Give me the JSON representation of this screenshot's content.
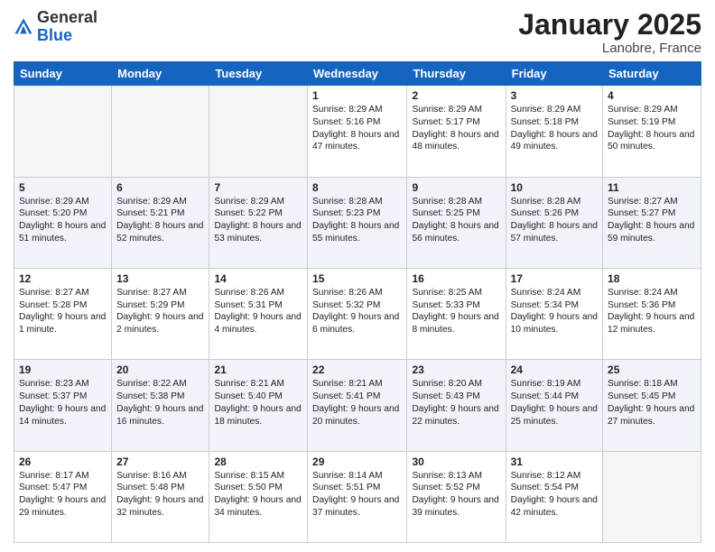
{
  "logo": {
    "general": "General",
    "blue": "Blue"
  },
  "header": {
    "month_year": "January 2025",
    "location": "Lanobre, France"
  },
  "days_of_week": [
    "Sunday",
    "Monday",
    "Tuesday",
    "Wednesday",
    "Thursday",
    "Friday",
    "Saturday"
  ],
  "weeks": [
    [
      {
        "day": "",
        "sunrise": "",
        "sunset": "",
        "daylight": ""
      },
      {
        "day": "",
        "sunrise": "",
        "sunset": "",
        "daylight": ""
      },
      {
        "day": "",
        "sunrise": "",
        "sunset": "",
        "daylight": ""
      },
      {
        "day": "1",
        "sunrise": "Sunrise: 8:29 AM",
        "sunset": "Sunset: 5:16 PM",
        "daylight": "Daylight: 8 hours and 47 minutes."
      },
      {
        "day": "2",
        "sunrise": "Sunrise: 8:29 AM",
        "sunset": "Sunset: 5:17 PM",
        "daylight": "Daylight: 8 hours and 48 minutes."
      },
      {
        "day": "3",
        "sunrise": "Sunrise: 8:29 AM",
        "sunset": "Sunset: 5:18 PM",
        "daylight": "Daylight: 8 hours and 49 minutes."
      },
      {
        "day": "4",
        "sunrise": "Sunrise: 8:29 AM",
        "sunset": "Sunset: 5:19 PM",
        "daylight": "Daylight: 8 hours and 50 minutes."
      }
    ],
    [
      {
        "day": "5",
        "sunrise": "Sunrise: 8:29 AM",
        "sunset": "Sunset: 5:20 PM",
        "daylight": "Daylight: 8 hours and 51 minutes."
      },
      {
        "day": "6",
        "sunrise": "Sunrise: 8:29 AM",
        "sunset": "Sunset: 5:21 PM",
        "daylight": "Daylight: 8 hours and 52 minutes."
      },
      {
        "day": "7",
        "sunrise": "Sunrise: 8:29 AM",
        "sunset": "Sunset: 5:22 PM",
        "daylight": "Daylight: 8 hours and 53 minutes."
      },
      {
        "day": "8",
        "sunrise": "Sunrise: 8:28 AM",
        "sunset": "Sunset: 5:23 PM",
        "daylight": "Daylight: 8 hours and 55 minutes."
      },
      {
        "day": "9",
        "sunrise": "Sunrise: 8:28 AM",
        "sunset": "Sunset: 5:25 PM",
        "daylight": "Daylight: 8 hours and 56 minutes."
      },
      {
        "day": "10",
        "sunrise": "Sunrise: 8:28 AM",
        "sunset": "Sunset: 5:26 PM",
        "daylight": "Daylight: 8 hours and 57 minutes."
      },
      {
        "day": "11",
        "sunrise": "Sunrise: 8:27 AM",
        "sunset": "Sunset: 5:27 PM",
        "daylight": "Daylight: 8 hours and 59 minutes."
      }
    ],
    [
      {
        "day": "12",
        "sunrise": "Sunrise: 8:27 AM",
        "sunset": "Sunset: 5:28 PM",
        "daylight": "Daylight: 9 hours and 1 minute."
      },
      {
        "day": "13",
        "sunrise": "Sunrise: 8:27 AM",
        "sunset": "Sunset: 5:29 PM",
        "daylight": "Daylight: 9 hours and 2 minutes."
      },
      {
        "day": "14",
        "sunrise": "Sunrise: 8:26 AM",
        "sunset": "Sunset: 5:31 PM",
        "daylight": "Daylight: 9 hours and 4 minutes."
      },
      {
        "day": "15",
        "sunrise": "Sunrise: 8:26 AM",
        "sunset": "Sunset: 5:32 PM",
        "daylight": "Daylight: 9 hours and 6 minutes."
      },
      {
        "day": "16",
        "sunrise": "Sunrise: 8:25 AM",
        "sunset": "Sunset: 5:33 PM",
        "daylight": "Daylight: 9 hours and 8 minutes."
      },
      {
        "day": "17",
        "sunrise": "Sunrise: 8:24 AM",
        "sunset": "Sunset: 5:34 PM",
        "daylight": "Daylight: 9 hours and 10 minutes."
      },
      {
        "day": "18",
        "sunrise": "Sunrise: 8:24 AM",
        "sunset": "Sunset: 5:36 PM",
        "daylight": "Daylight: 9 hours and 12 minutes."
      }
    ],
    [
      {
        "day": "19",
        "sunrise": "Sunrise: 8:23 AM",
        "sunset": "Sunset: 5:37 PM",
        "daylight": "Daylight: 9 hours and 14 minutes."
      },
      {
        "day": "20",
        "sunrise": "Sunrise: 8:22 AM",
        "sunset": "Sunset: 5:38 PM",
        "daylight": "Daylight: 9 hours and 16 minutes."
      },
      {
        "day": "21",
        "sunrise": "Sunrise: 8:21 AM",
        "sunset": "Sunset: 5:40 PM",
        "daylight": "Daylight: 9 hours and 18 minutes."
      },
      {
        "day": "22",
        "sunrise": "Sunrise: 8:21 AM",
        "sunset": "Sunset: 5:41 PM",
        "daylight": "Daylight: 9 hours and 20 minutes."
      },
      {
        "day": "23",
        "sunrise": "Sunrise: 8:20 AM",
        "sunset": "Sunset: 5:43 PM",
        "daylight": "Daylight: 9 hours and 22 minutes."
      },
      {
        "day": "24",
        "sunrise": "Sunrise: 8:19 AM",
        "sunset": "Sunset: 5:44 PM",
        "daylight": "Daylight: 9 hours and 25 minutes."
      },
      {
        "day": "25",
        "sunrise": "Sunrise: 8:18 AM",
        "sunset": "Sunset: 5:45 PM",
        "daylight": "Daylight: 9 hours and 27 minutes."
      }
    ],
    [
      {
        "day": "26",
        "sunrise": "Sunrise: 8:17 AM",
        "sunset": "Sunset: 5:47 PM",
        "daylight": "Daylight: 9 hours and 29 minutes."
      },
      {
        "day": "27",
        "sunrise": "Sunrise: 8:16 AM",
        "sunset": "Sunset: 5:48 PM",
        "daylight": "Daylight: 9 hours and 32 minutes."
      },
      {
        "day": "28",
        "sunrise": "Sunrise: 8:15 AM",
        "sunset": "Sunset: 5:50 PM",
        "daylight": "Daylight: 9 hours and 34 minutes."
      },
      {
        "day": "29",
        "sunrise": "Sunrise: 8:14 AM",
        "sunset": "Sunset: 5:51 PM",
        "daylight": "Daylight: 9 hours and 37 minutes."
      },
      {
        "day": "30",
        "sunrise": "Sunrise: 8:13 AM",
        "sunset": "Sunset: 5:52 PM",
        "daylight": "Daylight: 9 hours and 39 minutes."
      },
      {
        "day": "31",
        "sunrise": "Sunrise: 8:12 AM",
        "sunset": "Sunset: 5:54 PM",
        "daylight": "Daylight: 9 hours and 42 minutes."
      },
      {
        "day": "",
        "sunrise": "",
        "sunset": "",
        "daylight": ""
      }
    ]
  ]
}
